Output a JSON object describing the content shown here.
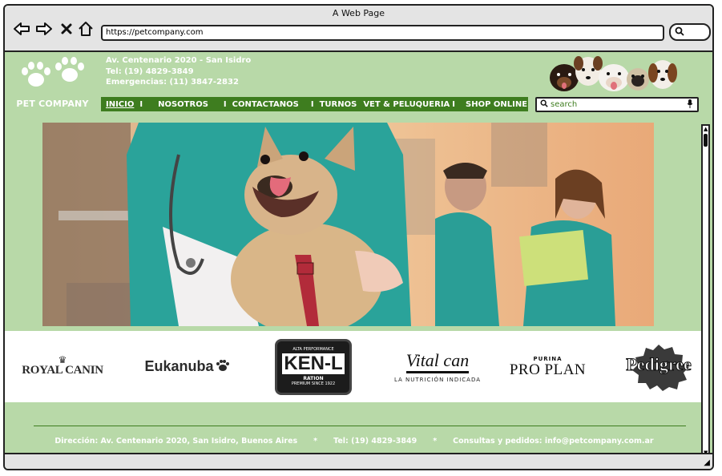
{
  "window": {
    "title": "A Web Page"
  },
  "browser": {
    "url": "https://petcompany.com",
    "back_icon": "arrow-left-icon",
    "forward_icon": "arrow-right-icon",
    "stop_icon": "close-icon",
    "home_icon": "home-icon",
    "search_icon": "search-icon"
  },
  "header": {
    "brand": "PET COMPANY",
    "address": "Av. Centenario 2020 - San Isidro",
    "phone": "Tel: (19) 4829-3849",
    "emergency": "Emergencias: (11) 3847-2832"
  },
  "menu": {
    "items": [
      {
        "label": "INICIO"
      },
      {
        "label": "NOSOTROS"
      },
      {
        "label": "CONTACTANOS"
      },
      {
        "label": "TURNOS"
      },
      {
        "label": "VET & PELUQUERIA"
      },
      {
        "label": "SHOP ONLINE"
      }
    ],
    "separator": "I"
  },
  "search": {
    "placeholder": "search"
  },
  "brands": {
    "royal_canin": "ROYAL CANIN",
    "eukanuba": "Eukanuba",
    "kenl": "KEN-L",
    "kenl_top": "ALTA PERFORMANCE",
    "kenl_ration": "RATION",
    "kenl_bottom": "PREMIUM SINCE 1922",
    "vitalcan": "Vital can",
    "vitalcan_tag": "LA NUTRICIÓN INDICADA",
    "purina": "PURINA",
    "proplan": "PRO PLAN",
    "pedigree": "Pedigree"
  },
  "footer": {
    "address": "Dirección: Av. Centenario 2020, San Isidro, Buenos Aires",
    "bullet": "*",
    "phone": "Tel: (19) 4829-3849",
    "contact": "Consultas y pedidos: info@petcompany.com.ar"
  },
  "colors": {
    "page_bg": "#b8d9a8",
    "menu_bg": "#3e7d1f",
    "accent": "#3e7d1f"
  }
}
